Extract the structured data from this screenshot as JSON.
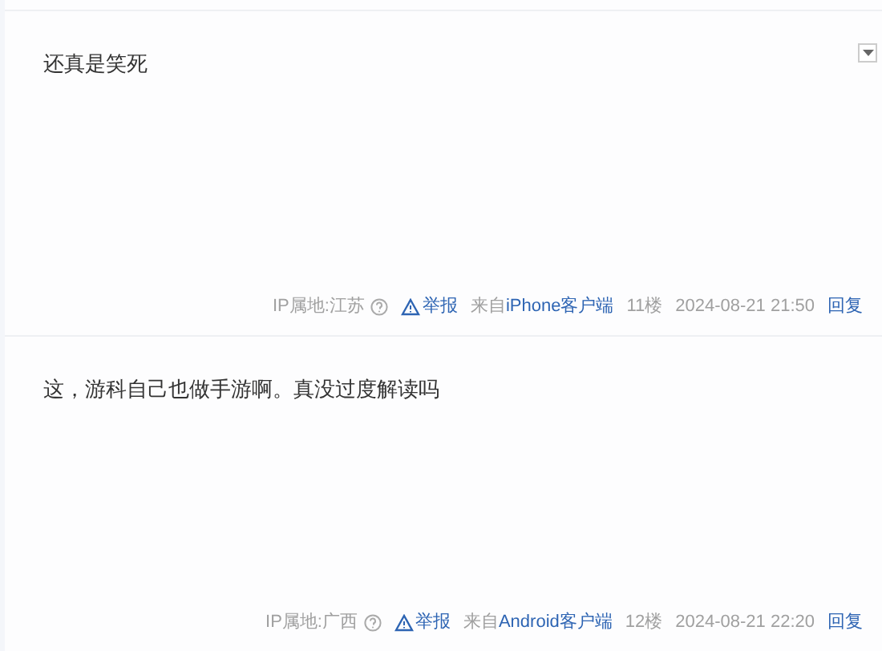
{
  "posts": [
    {
      "content": "还真是笑死",
      "menu_button": true,
      "meta": {
        "ip_location": "IP属地:江苏",
        "report": "举报",
        "source_prefix": "来自",
        "client": "iPhone客户端",
        "floor": "11楼",
        "time": "2024-08-21 21:50",
        "reply": "回复"
      }
    },
    {
      "content": "这，游科自己也做手游啊。真没过度解读吗",
      "menu_button": false,
      "meta": {
        "ip_location": "IP属地:广西",
        "report": "举报",
        "source_prefix": "来自",
        "client": "Android客户端",
        "floor": "12楼",
        "time": "2024-08-21 22:20",
        "reply": "回复"
      }
    }
  ]
}
